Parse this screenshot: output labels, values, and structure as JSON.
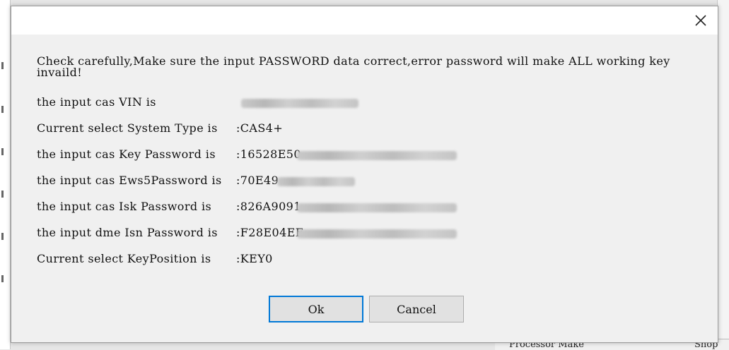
{
  "background": {
    "bottom_label": "Processor Make",
    "bottom_label_right": "Shop"
  },
  "dialog": {
    "warning": "Check carefully,Make sure the input PASSWORD data correct,error password will make ALL working key invaild!",
    "rows": [
      {
        "label": "the input cas VIN is",
        "value": ""
      },
      {
        "label": "Current select System Type is",
        "value": ":CAS4+"
      },
      {
        "label": "the input cas Key Password is",
        "value": ":16528E50"
      },
      {
        "label": "the input cas Ews5Password is",
        "value": ":70E49"
      },
      {
        "label": "the input cas Isk Password is",
        "value": ":826A9091"
      },
      {
        "label": "the input dme Isn Password is",
        "value": ":F28E04EE"
      },
      {
        "label": "Current select KeyPosition is",
        "value": ":KEY0"
      }
    ],
    "buttons": {
      "ok_label": "Ok",
      "cancel_label": "Cancel"
    },
    "close_icon": "close-icon"
  }
}
